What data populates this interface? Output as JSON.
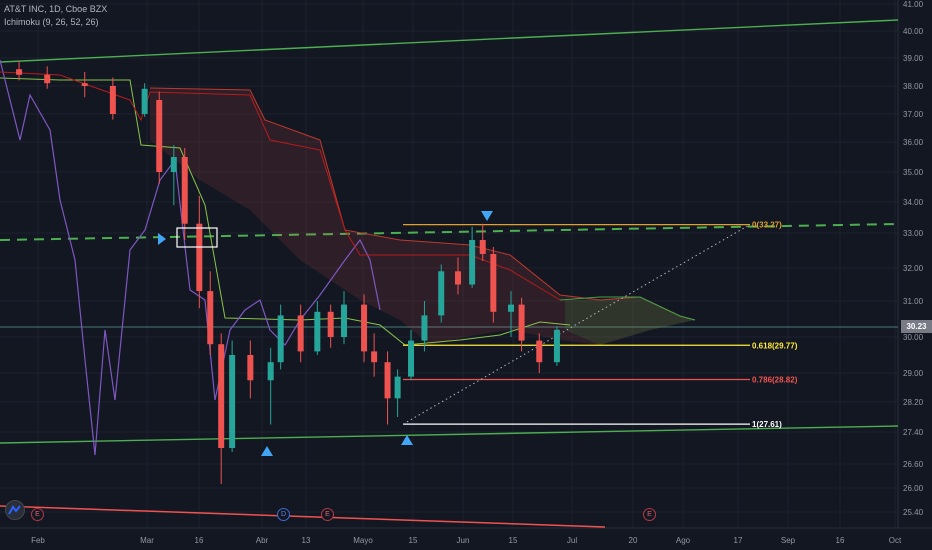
{
  "legend": {
    "symbol": "AT&T INC, 1D, Cboe BZX",
    "indicator": "Ichimoku (9, 26, 52, 26)"
  },
  "last_price": "30.23",
  "chart_data": {
    "type": "candlestick",
    "y_axis": {
      "ticks": [
        "41.00",
        "40.00",
        "39.00",
        "38.00",
        "37.00",
        "36.00",
        "35.00",
        "34.00",
        "33.00",
        "32.00",
        "31.00",
        "30.00",
        "29.00",
        "28.20",
        "27.40",
        "26.60",
        "26.00",
        "25.40"
      ]
    },
    "x_axis": {
      "ticks": [
        "Feb",
        "Mar",
        "16",
        "Abr",
        "13",
        "Mayo",
        "15",
        "Jun",
        "15",
        "Jul",
        "20",
        "Ago",
        "17",
        "Sep",
        "16",
        "Oct"
      ]
    },
    "candles": [
      {
        "d": "Feb 04",
        "o": 38.6,
        "h": 38.9,
        "l": 38.2,
        "c": 38.4
      },
      {
        "d": "Feb 10",
        "o": 38.4,
        "h": 38.7,
        "l": 37.9,
        "c": 38.1
      },
      {
        "d": "Feb 18",
        "o": 38.1,
        "h": 38.5,
        "l": 37.6,
        "c": 38.0
      },
      {
        "d": "Feb 24",
        "o": 38.0,
        "h": 38.3,
        "l": 36.8,
        "c": 37.0
      },
      {
        "d": "Mar 02",
        "o": 37.0,
        "h": 38.1,
        "l": 36.9,
        "c": 37.9
      },
      {
        "d": "Mar 06",
        "o": 37.5,
        "h": 37.8,
        "l": 34.6,
        "c": 35.0
      },
      {
        "d": "Mar 10",
        "o": 35.0,
        "h": 35.9,
        "l": 33.9,
        "c": 35.5
      },
      {
        "d": "Mar 13",
        "o": 35.5,
        "h": 35.8,
        "l": 32.8,
        "c": 33.3
      },
      {
        "d": "Mar 17",
        "o": 33.3,
        "h": 34.2,
        "l": 30.8,
        "c": 31.3
      },
      {
        "d": "Mar 20",
        "o": 31.3,
        "h": 31.9,
        "l": 29.5,
        "c": 29.8
      },
      {
        "d": "Mar 23",
        "o": 29.8,
        "h": 30.1,
        "l": 26.1,
        "c": 27.0
      },
      {
        "d": "Mar 26",
        "o": 27.0,
        "h": 29.9,
        "l": 26.9,
        "c": 29.5
      },
      {
        "d": "Mar 31",
        "o": 29.5,
        "h": 29.9,
        "l": 28.3,
        "c": 28.8
      },
      {
        "d": "Abr 06",
        "o": 28.8,
        "h": 29.7,
        "l": 27.6,
        "c": 29.3
      },
      {
        "d": "Abr 09",
        "o": 29.3,
        "h": 30.9,
        "l": 29.1,
        "c": 30.6
      },
      {
        "d": "Abr 15",
        "o": 30.6,
        "h": 30.9,
        "l": 29.3,
        "c": 29.6
      },
      {
        "d": "Abr 20",
        "o": 29.6,
        "h": 31.0,
        "l": 29.5,
        "c": 30.7
      },
      {
        "d": "Abr 24",
        "o": 30.7,
        "h": 30.9,
        "l": 29.7,
        "c": 30.0
      },
      {
        "d": "Abr 28",
        "o": 30.0,
        "h": 31.3,
        "l": 29.8,
        "c": 30.9
      },
      {
        "d": "May 04",
        "o": 30.9,
        "h": 31.2,
        "l": 29.3,
        "c": 29.6
      },
      {
        "d": "May 07",
        "o": 29.6,
        "h": 30.1,
        "l": 28.9,
        "c": 29.3
      },
      {
        "d": "May 11",
        "o": 29.3,
        "h": 29.6,
        "l": 27.6,
        "c": 28.3
      },
      {
        "d": "May 14",
        "o": 28.3,
        "h": 29.1,
        "l": 27.8,
        "c": 28.9
      },
      {
        "d": "May 18",
        "o": 28.9,
        "h": 30.2,
        "l": 28.8,
        "c": 29.9
      },
      {
        "d": "May 22",
        "o": 29.9,
        "h": 31.0,
        "l": 29.6,
        "c": 30.6
      },
      {
        "d": "May 27",
        "o": 30.6,
        "h": 32.1,
        "l": 30.4,
        "c": 31.9
      },
      {
        "d": "Jun 01",
        "o": 31.9,
        "h": 32.3,
        "l": 31.2,
        "c": 31.5
      },
      {
        "d": "Jun 05",
        "o": 31.5,
        "h": 33.2,
        "l": 31.4,
        "c": 32.8
      },
      {
        "d": "Jun 08",
        "o": 32.8,
        "h": 33.3,
        "l": 32.2,
        "c": 32.4
      },
      {
        "d": "Jun 11",
        "o": 32.4,
        "h": 32.6,
        "l": 30.4,
        "c": 30.7
      },
      {
        "d": "Jun 16",
        "o": 30.7,
        "h": 31.3,
        "l": 30.0,
        "c": 30.9
      },
      {
        "d": "Jun 19",
        "o": 30.9,
        "h": 31.1,
        "l": 29.6,
        "c": 29.9
      },
      {
        "d": "Jun 24",
        "o": 29.9,
        "h": 30.1,
        "l": 29.0,
        "c": 29.3
      },
      {
        "d": "Jun 29",
        "o": 29.3,
        "h": 30.3,
        "l": 29.2,
        "c": 30.2
      }
    ],
    "fibonacci": [
      {
        "label": "0(33.27)",
        "value": 33.27,
        "color": "#e0a030"
      },
      {
        "label": "0.618(29.77)",
        "value": 29.77,
        "color": "#ffeb3b"
      },
      {
        "label": "0.786(28.82)",
        "value": 28.82,
        "color": "#ef5350"
      },
      {
        "label": "1(27.61)",
        "value": 27.61,
        "color": "#ffffff"
      }
    ],
    "event_markers": [
      "E",
      "E",
      "D",
      "E",
      "E"
    ],
    "colors": {
      "up": "#26a69a",
      "down": "#ef5350",
      "tenkan": "#7e57c2",
      "lagging": "#9c7af0",
      "channel": "#4caf50"
    }
  }
}
